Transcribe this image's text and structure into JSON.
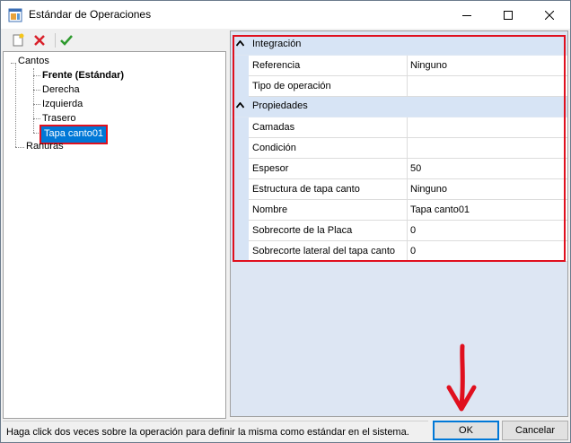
{
  "window": {
    "title": "Estándar de Operaciones",
    "controls": [
      "minimize-icon",
      "maximize-icon",
      "close-icon"
    ]
  },
  "toolbar": {
    "items": [
      {
        "name": "new-icon",
        "tooltip": ""
      },
      {
        "name": "delete-icon",
        "tooltip": ""
      },
      {
        "name": "check-icon",
        "tooltip": ""
      }
    ]
  },
  "tree": {
    "root": "Cantos",
    "children": [
      "Frente (Estándar)",
      "Derecha",
      "Izquierda",
      "Trasero",
      "Tapa canto01"
    ],
    "selected": "Tapa canto01",
    "sibling": "Ranuras"
  },
  "properties": {
    "categories": [
      {
        "label": "Integración",
        "rows": [
          {
            "name": "Referencia",
            "value": "Ninguno"
          },
          {
            "name": "Tipo de operación",
            "value": ""
          }
        ]
      },
      {
        "label": "Propiedades",
        "rows": [
          {
            "name": "Camadas",
            "value": ""
          },
          {
            "name": "Condición",
            "value": ""
          },
          {
            "name": "Espesor",
            "value": "50"
          },
          {
            "name": "Estructura de tapa canto",
            "value": "Ninguno"
          },
          {
            "name": "Nombre",
            "value": "Tapa canto01"
          },
          {
            "name": "Sobrecorte de la Placa",
            "value": "0"
          },
          {
            "name": "Sobrecorte lateral del tapa canto",
            "value": "0"
          }
        ]
      }
    ]
  },
  "status": {
    "text": "Haga click dos veces sobre la operación para definir la misma como estándar en el sistema."
  },
  "buttons": {
    "ok": "OK",
    "cancel": "Cancelar"
  },
  "annotations": {
    "highlight_color": "#e0101e",
    "arrow": "down-arrow-icon"
  },
  "colors": {
    "selection": "#0078d7",
    "category_bg": "#d7e4f5",
    "grid_bg": "#dde6f3"
  }
}
